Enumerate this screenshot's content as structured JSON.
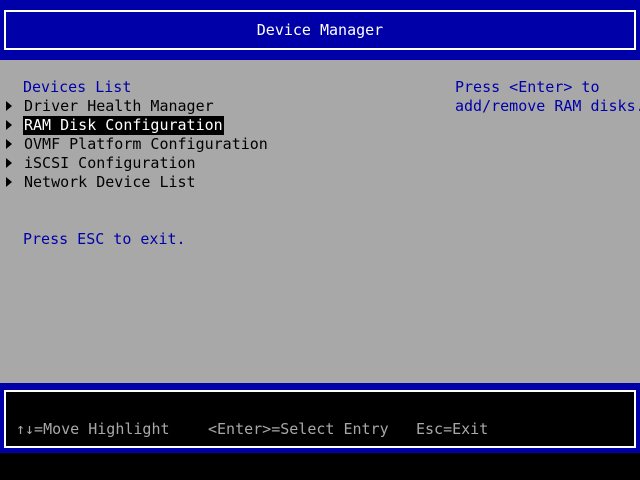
{
  "header": {
    "title": "Device Manager"
  },
  "devices_list": {
    "heading": "Devices List",
    "items": [
      {
        "label": "Driver Health Manager",
        "selected": false
      },
      {
        "label": "RAM Disk Configuration",
        "selected": true
      },
      {
        "label": "OVMF Platform Configuration",
        "selected": false
      },
      {
        "label": "iSCSI Configuration",
        "selected": false
      },
      {
        "label": "Network Device List",
        "selected": false
      }
    ],
    "exit_hint": "Press ESC to exit."
  },
  "help": {
    "line1": "Press <Enter> to",
    "line2": "add/remove RAM disks."
  },
  "footer": {
    "move_highlight": "↑↓=Move Highlight",
    "select_entry": "<Enter>=Select Entry",
    "exit": "Esc=Exit"
  },
  "colors": {
    "background": "#a8a8a8",
    "frame_blue": "#0000a8",
    "text_blue": "#0000a8",
    "text_black": "#000000",
    "highlight_bg": "#000000",
    "highlight_fg": "#ffffff"
  }
}
